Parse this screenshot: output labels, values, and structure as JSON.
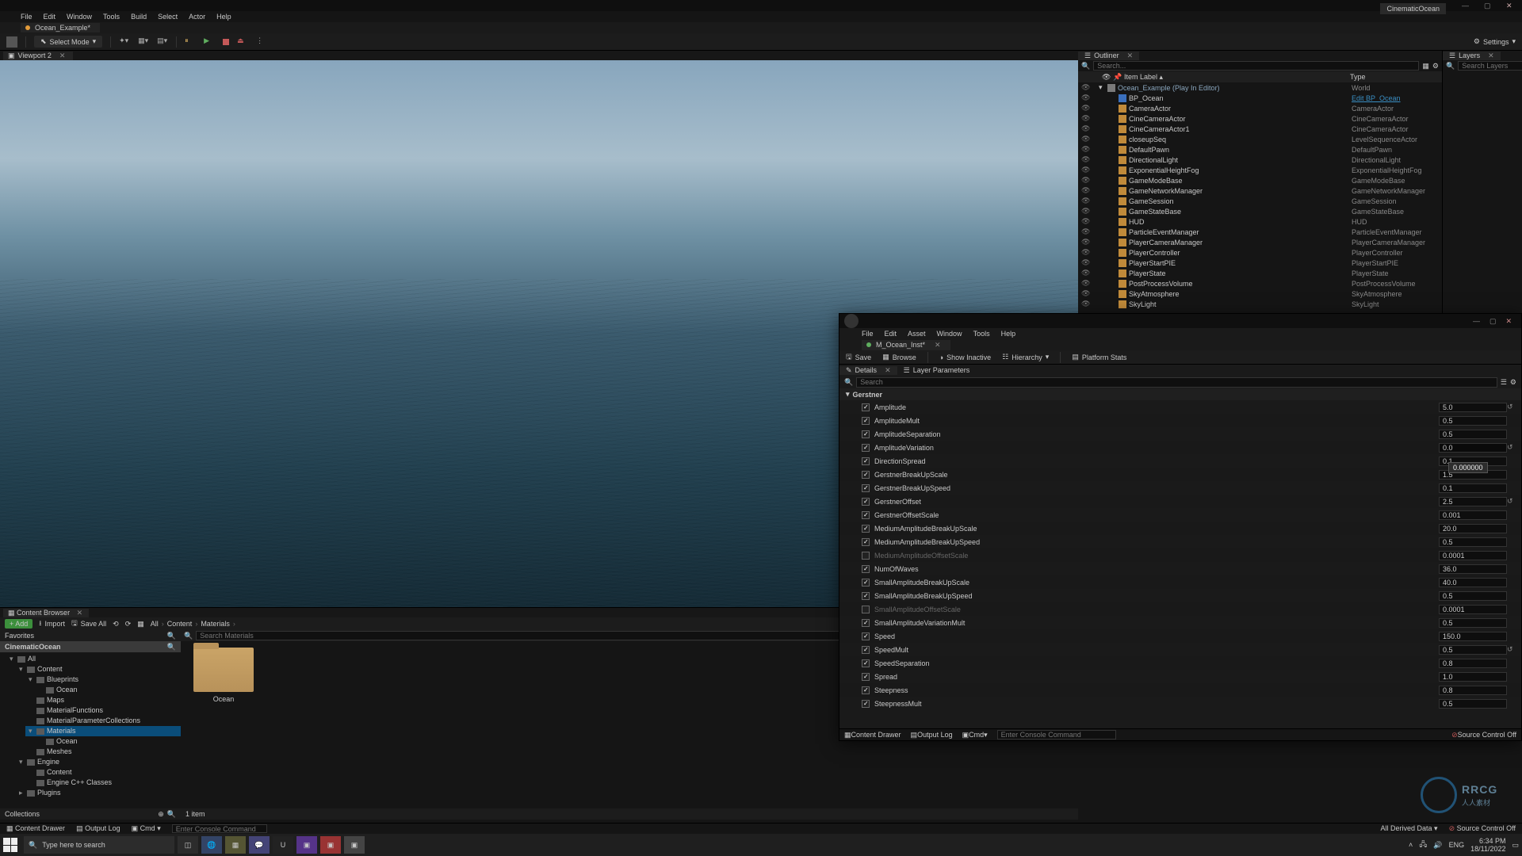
{
  "project_name": "CinematicOcean",
  "window": {
    "min": "—",
    "max": "▢",
    "close": "✕"
  },
  "menubar": [
    "File",
    "Edit",
    "Window",
    "Tools",
    "Build",
    "Select",
    "Actor",
    "Help"
  ],
  "level_tab": "Ocean_Example*",
  "toolbar": {
    "select_mode": "Select Mode",
    "settings": "Settings"
  },
  "viewport_tab": "Viewport 2",
  "outliner": {
    "tab": "Outliner",
    "layers_tab": "Layers",
    "search_placeholder": "Search...",
    "layers_search_placeholder": "Search Layers",
    "header_label": "Item Label",
    "header_type": "Type",
    "rows": [
      {
        "depth": 0,
        "exp": "▾",
        "ico": "wd",
        "name": "Ocean_Example (Play In Editor)",
        "type": "World",
        "world": true
      },
      {
        "depth": 1,
        "exp": "",
        "ico": "bp",
        "name": "BP_Ocean",
        "type": "Edit BP_Ocean",
        "link": true
      },
      {
        "depth": 1,
        "exp": "",
        "ico": "",
        "name": "CameraActor",
        "type": "CameraActor"
      },
      {
        "depth": 1,
        "exp": "",
        "ico": "",
        "name": "CineCameraActor",
        "type": "CineCameraActor"
      },
      {
        "depth": 1,
        "exp": "",
        "ico": "",
        "name": "CineCameraActor1",
        "type": "CineCameraActor"
      },
      {
        "depth": 1,
        "exp": "",
        "ico": "",
        "name": "closeupSeq",
        "type": "LevelSequenceActor"
      },
      {
        "depth": 1,
        "exp": "",
        "ico": "",
        "name": "DefaultPawn",
        "type": "DefaultPawn"
      },
      {
        "depth": 1,
        "exp": "",
        "ico": "",
        "name": "DirectionalLight",
        "type": "DirectionalLight"
      },
      {
        "depth": 1,
        "exp": "",
        "ico": "",
        "name": "ExponentialHeightFog",
        "type": "ExponentialHeightFog"
      },
      {
        "depth": 1,
        "exp": "",
        "ico": "",
        "name": "GameModeBase",
        "type": "GameModeBase"
      },
      {
        "depth": 1,
        "exp": "",
        "ico": "",
        "name": "GameNetworkManager",
        "type": "GameNetworkManager"
      },
      {
        "depth": 1,
        "exp": "",
        "ico": "",
        "name": "GameSession",
        "type": "GameSession"
      },
      {
        "depth": 1,
        "exp": "",
        "ico": "",
        "name": "GameStateBase",
        "type": "GameStateBase"
      },
      {
        "depth": 1,
        "exp": "",
        "ico": "",
        "name": "HUD",
        "type": "HUD"
      },
      {
        "depth": 1,
        "exp": "",
        "ico": "",
        "name": "ParticleEventManager",
        "type": "ParticleEventManager"
      },
      {
        "depth": 1,
        "exp": "",
        "ico": "",
        "name": "PlayerCameraManager",
        "type": "PlayerCameraManager"
      },
      {
        "depth": 1,
        "exp": "",
        "ico": "",
        "name": "PlayerController",
        "type": "PlayerController"
      },
      {
        "depth": 1,
        "exp": "",
        "ico": "",
        "name": "PlayerStartPIE",
        "type": "PlayerStartPIE"
      },
      {
        "depth": 1,
        "exp": "",
        "ico": "",
        "name": "PlayerState",
        "type": "PlayerState"
      },
      {
        "depth": 1,
        "exp": "",
        "ico": "",
        "name": "PostProcessVolume",
        "type": "PostProcessVolume"
      },
      {
        "depth": 1,
        "exp": "",
        "ico": "",
        "name": "SkyAtmosphere",
        "type": "SkyAtmosphere"
      },
      {
        "depth": 1,
        "exp": "",
        "ico": "",
        "name": "SkyLight",
        "type": "SkyLight"
      }
    ]
  },
  "content_browser": {
    "tab": "Content Browser",
    "add": "Add",
    "import": "Import",
    "save_all": "Save All",
    "breadcrumb": [
      "All",
      "Content",
      "Materials"
    ],
    "favorites": "Favorites",
    "root": "CinematicOcean",
    "tree": [
      {
        "d": 0,
        "exp": "▾",
        "name": "All"
      },
      {
        "d": 1,
        "exp": "▾",
        "name": "Content"
      },
      {
        "d": 2,
        "exp": "▾",
        "name": "Blueprints"
      },
      {
        "d": 3,
        "exp": "",
        "name": "Ocean"
      },
      {
        "d": 2,
        "exp": "",
        "name": "Maps"
      },
      {
        "d": 2,
        "exp": "",
        "name": "MaterialFunctions"
      },
      {
        "d": 2,
        "exp": "",
        "name": "MaterialParameterCollections"
      },
      {
        "d": 2,
        "exp": "▾",
        "name": "Materials",
        "sel": true
      },
      {
        "d": 3,
        "exp": "",
        "name": "Ocean"
      },
      {
        "d": 2,
        "exp": "",
        "name": "Meshes"
      },
      {
        "d": 1,
        "exp": "▾",
        "name": "Engine"
      },
      {
        "d": 2,
        "exp": "",
        "name": "Content"
      },
      {
        "d": 2,
        "exp": "",
        "name": "Engine C++ Classes"
      },
      {
        "d": 1,
        "exp": "▸",
        "name": "Plugins"
      }
    ],
    "collections": "Collections",
    "search_placeholder": "Search Materials",
    "folder_item": "Ocean",
    "item_count": "1 item"
  },
  "mi_editor": {
    "menubar": [
      "File",
      "Edit",
      "Asset",
      "Window",
      "Tools",
      "Help"
    ],
    "asset_tab": "M_Ocean_Inst*",
    "toolbar": {
      "save": "Save",
      "browse": "Browse",
      "show_inherit": "Show Inactive",
      "hierarchy": "Hierarchy",
      "platform_stats": "Platform Stats"
    },
    "details_tab": "Details",
    "layer_params_tab": "Layer Parameters",
    "search_placeholder": "Search",
    "reset_group": "Reset",
    "group": "Gerstner",
    "tooltip": "0.000000",
    "params": [
      {
        "on": true,
        "name": "Amplitude",
        "val": "5.0",
        "reset": true
      },
      {
        "on": true,
        "name": "AmplitudeMult",
        "val": "0.5"
      },
      {
        "on": true,
        "name": "AmplitudeSeparation",
        "val": "0.5"
      },
      {
        "on": true,
        "name": "AmplitudeVariation",
        "val": "0.0",
        "editing": true,
        "reset": true
      },
      {
        "on": true,
        "name": "DirectionSpread",
        "val": "0.1"
      },
      {
        "on": true,
        "name": "GerstnerBreakUpScale",
        "val": "1.5"
      },
      {
        "on": true,
        "name": "GerstnerBreakUpSpeed",
        "val": "0.1"
      },
      {
        "on": true,
        "name": "GerstnerOffset",
        "val": "2.5",
        "reset": true
      },
      {
        "on": true,
        "name": "GerstnerOffsetScale",
        "val": "0.001"
      },
      {
        "on": true,
        "name": "MediumAmplitudeBreakUpScale",
        "val": "20.0"
      },
      {
        "on": true,
        "name": "MediumAmplitudeBreakUpSpeed",
        "val": "0.5"
      },
      {
        "on": false,
        "name": "MediumAmplitudeOffsetScale",
        "val": "0.0001"
      },
      {
        "on": true,
        "name": "NumOfWaves",
        "val": "36.0"
      },
      {
        "on": true,
        "name": "SmallAmplitudeBreakUpScale",
        "val": "40.0"
      },
      {
        "on": true,
        "name": "SmallAmplitudeBreakUpSpeed",
        "val": "0.5"
      },
      {
        "on": false,
        "name": "SmallAmplitudeOffsetScale",
        "val": "0.0001"
      },
      {
        "on": true,
        "name": "SmallAmplitudeVariationMult",
        "val": "0.5"
      },
      {
        "on": true,
        "name": "Speed",
        "val": "150.0"
      },
      {
        "on": true,
        "name": "SpeedMult",
        "val": "0.5",
        "reset": true
      },
      {
        "on": true,
        "name": "SpeedSeparation",
        "val": "0.8"
      },
      {
        "on": true,
        "name": "Spread",
        "val": "1.0"
      },
      {
        "on": true,
        "name": "Steepness",
        "val": "0.8"
      },
      {
        "on": true,
        "name": "SteepnessMult",
        "val": "0.5"
      }
    ],
    "status": {
      "content_drawer": "Content Drawer",
      "output_log": "Output Log",
      "cmd": "Cmd",
      "cmd_placeholder": "Enter Console Command",
      "source_control": "Source Control Off"
    }
  },
  "statusbar": {
    "content_drawer": "Content Drawer",
    "output_log": "Output Log",
    "cmd": "Cmd",
    "cmd_placeholder": "Enter Console Command",
    "derived": "All Derived Data",
    "source_control": "Source Control Off"
  },
  "watermark": {
    "txt": "RRCG",
    "sub": "人人素材"
  },
  "taskbar": {
    "search": "Type here to search",
    "time": "6:34 PM",
    "date": "18/11/2022",
    "lang": "ENG"
  }
}
